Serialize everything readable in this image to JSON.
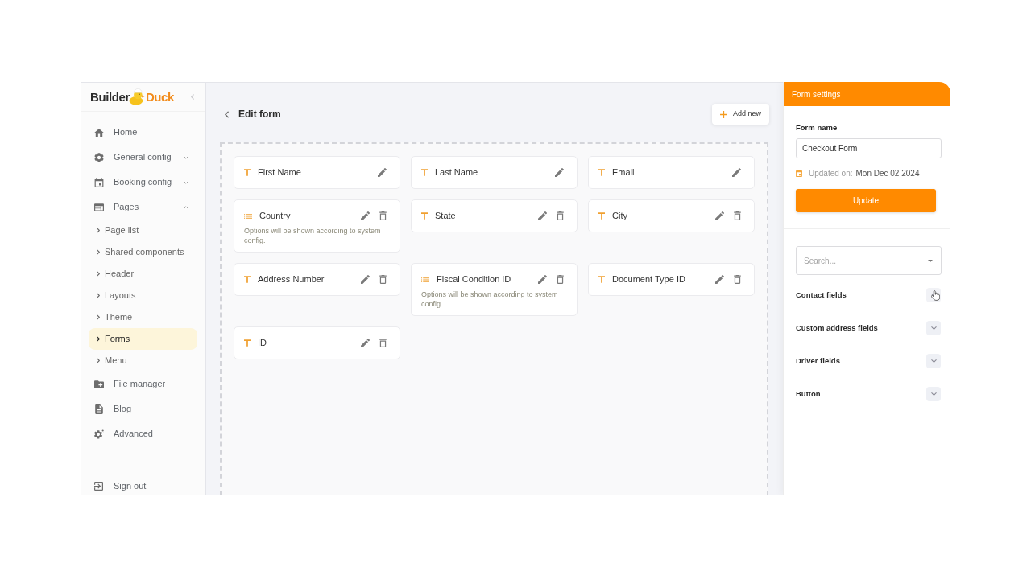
{
  "sidebar": {
    "logo": {
      "text_1": "Builder",
      "text_2": "Duck"
    },
    "items": [
      {
        "label": "Home",
        "kind": "link",
        "selected": false
      },
      {
        "label": "General config",
        "kind": "group",
        "expanded": false,
        "selected": false
      },
      {
        "label": "Booking config",
        "kind": "group",
        "expanded": false,
        "selected": false
      },
      {
        "label": "Pages",
        "kind": "group",
        "expanded": true,
        "selected": false,
        "children": [
          {
            "label": "Page list",
            "selected": false
          },
          {
            "label": "Shared components",
            "selected": false
          },
          {
            "label": "Header",
            "selected": false
          },
          {
            "label": "Layouts",
            "selected": false
          },
          {
            "label": "Theme",
            "selected": false
          },
          {
            "label": "Forms",
            "selected": true
          },
          {
            "label": "Menu",
            "selected": false
          }
        ]
      },
      {
        "label": "File manager",
        "kind": "link",
        "selected": false
      },
      {
        "label": "Blog",
        "kind": "link",
        "selected": false
      },
      {
        "label": "Advanced",
        "kind": "link",
        "selected": false
      }
    ],
    "footer_item": {
      "label": "Sign out"
    }
  },
  "header": {
    "title": "Edit form",
    "add_button": "Add new"
  },
  "fields": [
    {
      "label": "First Name",
      "kind": "text",
      "deletable": false
    },
    {
      "label": "Last Name",
      "kind": "text",
      "deletable": false
    },
    {
      "label": "Email",
      "kind": "text",
      "deletable": false
    },
    {
      "label": "Country",
      "kind": "select",
      "deletable": true,
      "description": "Options will be shown according to system config."
    },
    {
      "label": "State",
      "kind": "text",
      "deletable": true
    },
    {
      "label": "City",
      "kind": "text",
      "deletable": true
    },
    {
      "label": "Address Number",
      "kind": "text",
      "deletable": true
    },
    {
      "label": "Fiscal Condition ID",
      "kind": "select",
      "deletable": true,
      "description": "Options will be shown according to system config."
    },
    {
      "label": "Document Type ID",
      "kind": "text",
      "deletable": true
    },
    {
      "label": "ID",
      "kind": "text",
      "deletable": true
    }
  ],
  "settings": {
    "title": "Form settings",
    "form_name": {
      "label": "Form name",
      "value": "Checkout Form"
    },
    "updated": {
      "label": "Updated on:",
      "value": "Mon Dec 02 2024"
    },
    "update_button": "Update",
    "search": {
      "placeholder": "Search..."
    },
    "sections": [
      {
        "label": "Contact fields",
        "expanded": false,
        "hovered": true
      },
      {
        "label": "Custom address fields",
        "expanded": false,
        "hovered": false
      },
      {
        "label": "Driver fields",
        "expanded": false,
        "hovered": false
      },
      {
        "label": "Button",
        "expanded": false,
        "hovered": false
      }
    ]
  }
}
